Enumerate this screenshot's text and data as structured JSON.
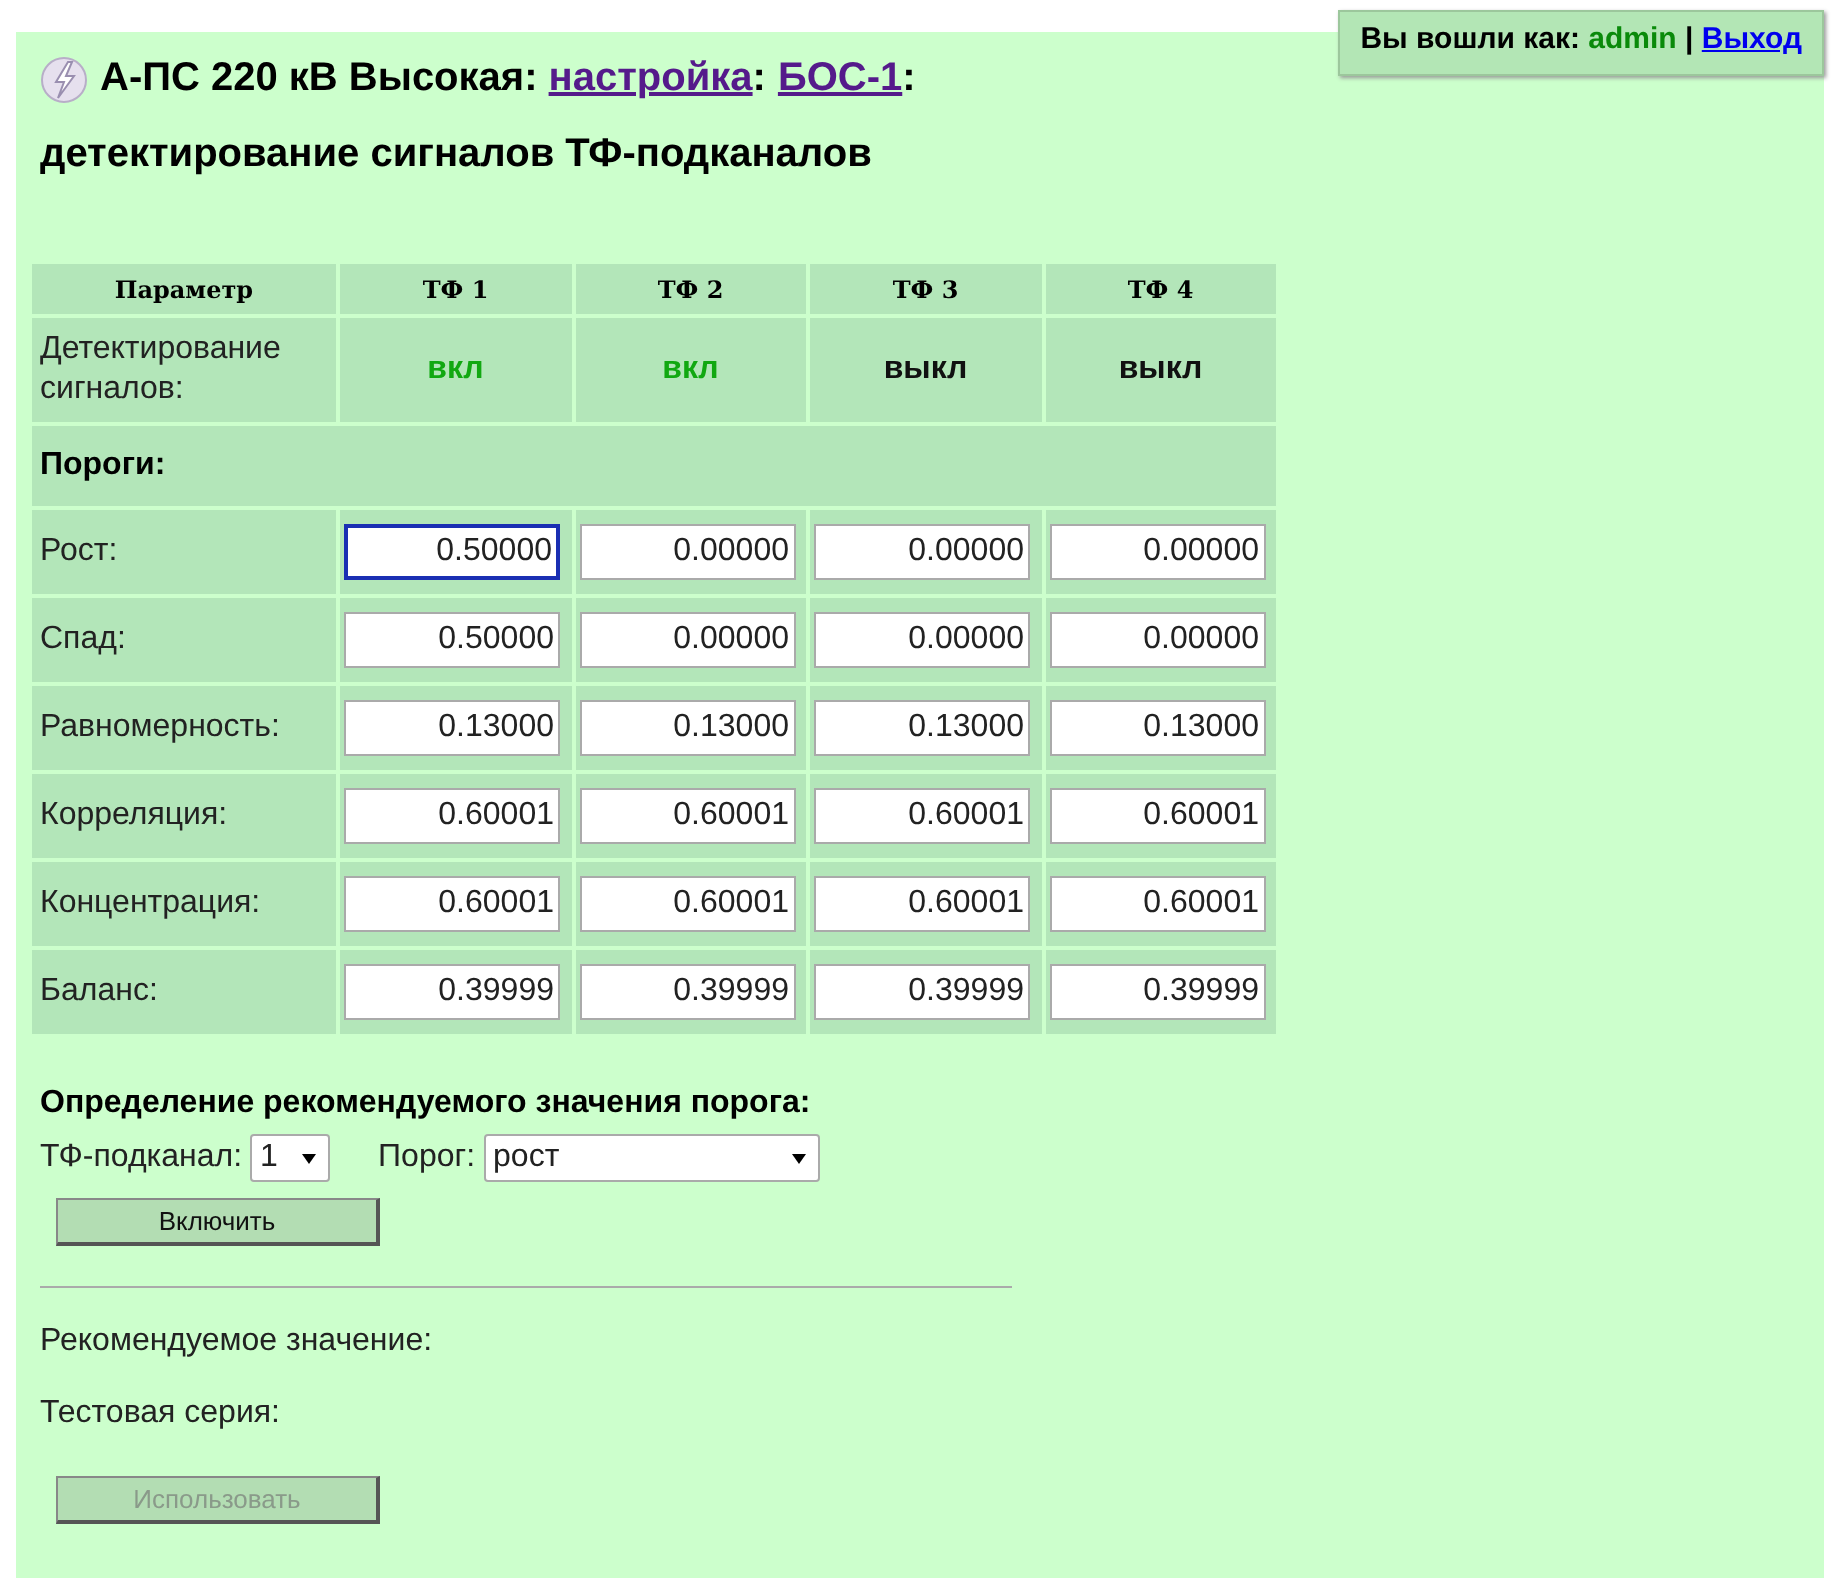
{
  "header": {
    "title_prefix": "А-ПС 220 кВ Высокая: ",
    "links": [
      {
        "text": "настройка",
        "after": ":"
      },
      {
        "text": "БОС-1",
        "after": ":"
      }
    ],
    "subtitle": "детектирование сигналов ТФ-подканалов"
  },
  "login": {
    "label": "Вы вошли как: ",
    "user": "admin",
    "separator": " | ",
    "logout": "Выход"
  },
  "table": {
    "columns": [
      "Параметр",
      "ТФ 1",
      "ТФ 2",
      "ТФ 3",
      "ТФ 4"
    ],
    "detection": {
      "label": "Детектирование сигналов:",
      "channels": [
        {
          "text": "вкл",
          "on": true
        },
        {
          "text": "вкл",
          "on": true
        },
        {
          "text": "выкл",
          "on": false
        },
        {
          "text": "выкл",
          "on": false
        }
      ]
    },
    "section": "Пороги:",
    "rows": [
      {
        "label": "Рост:",
        "values": [
          {
            "value": "0.50000",
            "focused": true
          },
          {
            "value": "0.00000",
            "focused": false
          },
          {
            "value": "0.00000",
            "focused": false
          },
          {
            "value": "0.00000",
            "focused": false
          }
        ]
      },
      {
        "label": "Спад:",
        "values": [
          {
            "value": "0.50000",
            "focused": false
          },
          {
            "value": "0.00000",
            "focused": false
          },
          {
            "value": "0.00000",
            "focused": false
          },
          {
            "value": "0.00000",
            "focused": false
          }
        ]
      },
      {
        "label": "Равномерность:",
        "values": [
          {
            "value": "0.13000",
            "focused": false
          },
          {
            "value": "0.13000",
            "focused": false
          },
          {
            "value": "0.13000",
            "focused": false
          },
          {
            "value": "0.13000",
            "focused": false
          }
        ]
      },
      {
        "label": "Корреляция:",
        "values": [
          {
            "value": "0.60001",
            "focused": false
          },
          {
            "value": "0.60001",
            "focused": false
          },
          {
            "value": "0.60001",
            "focused": false
          },
          {
            "value": "0.60001",
            "focused": false
          }
        ]
      },
      {
        "label": "Концентрация:",
        "values": [
          {
            "value": "0.60001",
            "focused": false
          },
          {
            "value": "0.60001",
            "focused": false
          },
          {
            "value": "0.60001",
            "focused": false
          },
          {
            "value": "0.60001",
            "focused": false
          }
        ]
      },
      {
        "label": "Баланс:",
        "values": [
          {
            "value": "0.39999",
            "focused": false
          },
          {
            "value": "0.39999",
            "focused": false
          },
          {
            "value": "0.39999",
            "focused": false
          },
          {
            "value": "0.39999",
            "focused": false
          }
        ]
      }
    ]
  },
  "recommend": {
    "heading": "Определение рекомендуемого значения порога:",
    "channel_label": "ТФ-подканал:",
    "channel_value": "1",
    "threshold_label": "Порог:",
    "threshold_value": "рост",
    "enable_button": {
      "label": "Включить",
      "disabled": false
    },
    "result_label": "Рекомендуемое значение:",
    "series_label": "Тестовая серия:",
    "use_button": {
      "label": "Использовать",
      "disabled": true
    }
  }
}
